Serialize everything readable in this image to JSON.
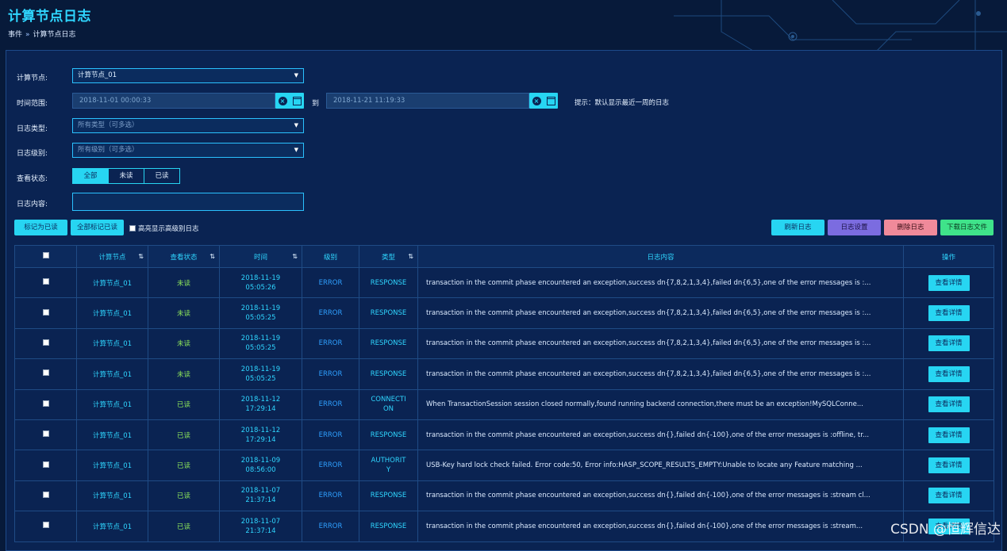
{
  "page": {
    "title": "计算节点日志",
    "breadcrumb": [
      "事件",
      "计算节点日志"
    ],
    "breadcrumb_sep": "»"
  },
  "form": {
    "node_label": "计算节点:",
    "node_value": "计算节点_01",
    "time_label": "时间范围:",
    "time_start": "2018-11-01 00:00:33",
    "time_to": "到",
    "time_end": "2018-11-21 11:19:33",
    "time_hint": "提示：默认显示最近一周的日志",
    "type_label": "日志类型:",
    "type_placeholder": "所有类型（可多选）",
    "level_label": "日志级别:",
    "level_placeholder": "所有级别（可多选）",
    "status_label": "查看状态:",
    "status_options": [
      "全部",
      "未读",
      "已读"
    ],
    "status_selected": "全部",
    "content_label": "日志内容:",
    "content_value": ""
  },
  "toolbar": {
    "mark_read": "标记为已读",
    "mark_all_read": "全部标记已读",
    "highlight": "高亮显示高级别日志",
    "refresh": "刷新日志",
    "settings": "日志设置",
    "delete": "删除日志",
    "download": "下载日志文件"
  },
  "table": {
    "columns": [
      "计算节点",
      "查看状态",
      "时间",
      "级别",
      "类型",
      "日志内容",
      "操作"
    ],
    "rows": [
      {
        "node": "计算节点_01",
        "status": "未读",
        "date": "2018-11-19",
        "time": "05:05:26",
        "level": "ERROR",
        "type": [
          "RESPONSE"
        ],
        "content": "transaction in the commit phase encountered an exception,success dn{7,8,2,1,3,4},failed dn{6,5},one of the error messages is :...",
        "action": "查看详情"
      },
      {
        "node": "计算节点_01",
        "status": "未读",
        "date": "2018-11-19",
        "time": "05:05:25",
        "level": "ERROR",
        "type": [
          "RESPONSE"
        ],
        "content": "transaction in the commit phase encountered an exception,success dn{7,8,2,1,3,4},failed dn{6,5},one of the error messages is :...",
        "action": "查看详情"
      },
      {
        "node": "计算节点_01",
        "status": "未读",
        "date": "2018-11-19",
        "time": "05:05:25",
        "level": "ERROR",
        "type": [
          "RESPONSE"
        ],
        "content": "transaction in the commit phase encountered an exception,success dn{7,8,2,1,3,4},failed dn{6,5},one of the error messages is :...",
        "action": "查看详情"
      },
      {
        "node": "计算节点_01",
        "status": "未读",
        "date": "2018-11-19",
        "time": "05:05:25",
        "level": "ERROR",
        "type": [
          "RESPONSE"
        ],
        "content": "transaction in the commit phase encountered an exception,success dn{7,8,2,1,3,4},failed dn{6,5},one of the error messages is :...",
        "action": "查看详情"
      },
      {
        "node": "计算节点_01",
        "status": "已读",
        "date": "2018-11-12",
        "time": "17:29:14",
        "level": "ERROR",
        "type": [
          "CONNECTI",
          "ON"
        ],
        "content": "When TransactionSession session closed normally,found running backend connection,there must be an exception!MySQLConne...",
        "action": "查看详情"
      },
      {
        "node": "计算节点_01",
        "status": "已读",
        "date": "2018-11-12",
        "time": "17:29:14",
        "level": "ERROR",
        "type": [
          "RESPONSE"
        ],
        "content": "transaction in the commit phase encountered an exception,success dn{},failed dn{-100},one of the error messages is :offline, tr...",
        "action": "查看详情"
      },
      {
        "node": "计算节点_01",
        "status": "已读",
        "date": "2018-11-09",
        "time": "08:56:00",
        "level": "ERROR",
        "type": [
          "AUTHORIT",
          "Y"
        ],
        "content": "USB-Key hard lock check failed. Error code:50, Error info:HASP_SCOPE_RESULTS_EMPTY:Unable to locate any Feature matching ...",
        "action": "查看详情"
      },
      {
        "node": "计算节点_01",
        "status": "已读",
        "date": "2018-11-07",
        "time": "21:37:14",
        "level": "ERROR",
        "type": [
          "RESPONSE"
        ],
        "content": "transaction in the commit phase encountered an exception,success dn{},failed dn{-100},one of the error messages is :stream cl...",
        "action": "查看详情"
      },
      {
        "node": "计算节点_01",
        "status": "已读",
        "date": "2018-11-07",
        "time": "21:37:14",
        "level": "ERROR",
        "type": [
          "RESPONSE"
        ],
        "content": "transaction in the commit phase encountered an exception,success dn{},failed dn{-100},one of the error messages is :stream...",
        "action": "查看详情"
      }
    ]
  },
  "watermark": "CSDN @恒辉信达",
  "colors": {
    "accent": "#27d5f2",
    "background": "#071a3a",
    "panel": "#0a2352"
  }
}
